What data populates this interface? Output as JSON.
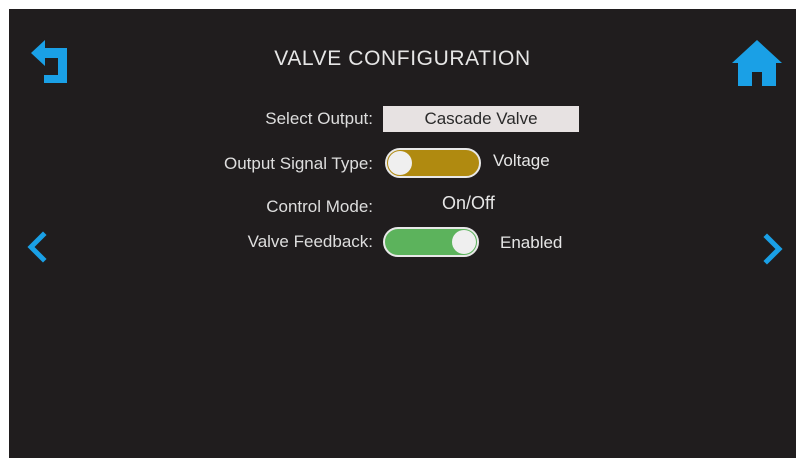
{
  "header": {
    "title": "VALVE CONFIGURATION"
  },
  "icons": {
    "back": "back-arrow-icon",
    "home": "home-icon",
    "prev": "chevron-left-icon",
    "next": "chevron-right-icon"
  },
  "settings": {
    "select_output": {
      "label": "Select Output:",
      "value": "Cascade Valve"
    },
    "output_signal_type": {
      "label": "Output Signal Type:",
      "value": "Voltage",
      "toggle_color": "#b08a10",
      "toggle_on": false
    },
    "control_mode": {
      "label": "Control Mode:",
      "value": "On/Off"
    },
    "valve_feedback": {
      "label": "Valve Feedback:",
      "value": "Enabled",
      "toggle_color": "#5cb35c",
      "toggle_on": true
    }
  },
  "colors": {
    "background": "#201d1e",
    "accent_blue": "#1aa0e6",
    "text": "#e4e4e4"
  }
}
